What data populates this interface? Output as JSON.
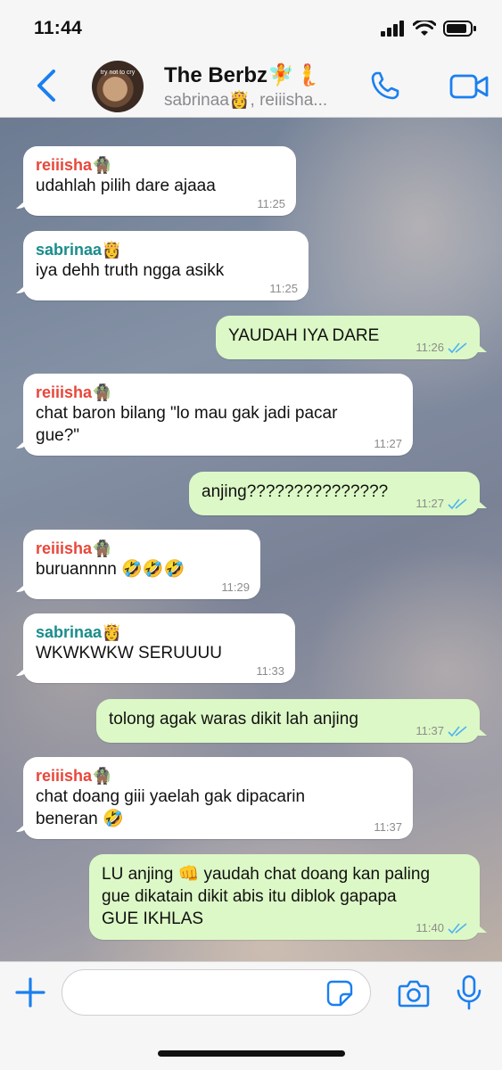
{
  "status_bar": {
    "time": "11:44"
  },
  "header": {
    "title": "The Berbz🧚🧜",
    "subtitle": "sabrinaa👸, reiiisha...",
    "avatar_text": "try not to cry"
  },
  "colors": {
    "accent": "#1a7ff0",
    "outgoing_bubble": "#dcf8c6",
    "incoming_bubble": "#ffffff",
    "sender_reiiisha": "#e8473b",
    "sender_sabrinaa": "#1a8c8c",
    "read_ticks": "#4fb3f0"
  },
  "messages": [
    {
      "direction": "in",
      "sender": "reiiisha🧌",
      "sender_color": "#e8473b",
      "text": "udahlah pilih dare ajaaa",
      "time": "11:25"
    },
    {
      "direction": "in",
      "sender": "sabrinaa👸",
      "sender_color": "#1a8c8c",
      "text": "iya dehh truth ngga asikk",
      "time": "11:25"
    },
    {
      "direction": "out",
      "text": "YAUDAH IYA DARE",
      "time": "11:26",
      "status": "read"
    },
    {
      "direction": "in",
      "sender": "reiiisha🧌",
      "sender_color": "#e8473b",
      "text": "chat baron bilang \"lo mau gak jadi pacar\ngue?\"",
      "time": "11:27"
    },
    {
      "direction": "out",
      "text": "anjing???????????????",
      "time": "11:27",
      "status": "read"
    },
    {
      "direction": "in",
      "sender": "reiiisha🧌",
      "sender_color": "#e8473b",
      "text": "buruannnn 🤣🤣🤣",
      "time": "11:29"
    },
    {
      "direction": "in",
      "sender": "sabrinaa👸",
      "sender_color": "#1a8c8c",
      "text": "WKWKWKW SERUUUU",
      "time": "11:33"
    },
    {
      "direction": "out",
      "text": "tolong agak waras dikit lah anjing",
      "time": "11:37",
      "status": "read"
    },
    {
      "direction": "in",
      "sender": "reiiisha🧌",
      "sender_color": "#e8473b",
      "text": "chat doang giii yaelah gak dipacarin\nbeneran 🤣",
      "time": "11:37"
    },
    {
      "direction": "out",
      "text": "LU anjing 👊 yaudah chat doang kan paling\ngue dikatain dikit abis itu diblok gapapa\nGUE IKHLAS",
      "time": "11:40",
      "status": "read"
    }
  ],
  "input": {
    "placeholder": "",
    "value": ""
  },
  "icons": {
    "back": "chevron-left-icon",
    "call": "phone-icon",
    "video": "video-camera-icon",
    "plus": "plus-icon",
    "sticker": "sticker-icon",
    "camera": "camera-icon",
    "mic": "microphone-icon"
  }
}
